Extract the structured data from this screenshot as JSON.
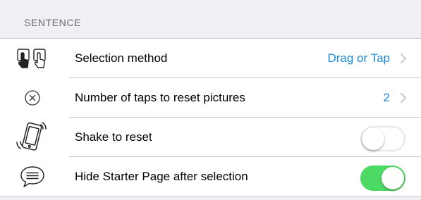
{
  "section": {
    "title": "SENTENCE"
  },
  "rows": [
    {
      "icon": "hand-touch-icon",
      "label": "Selection method",
      "value": "Drag or Tap",
      "accessory": "chevron"
    },
    {
      "icon": "circle-x-icon",
      "label": "Number of taps to reset pictures",
      "value": "2",
      "accessory": "chevron"
    },
    {
      "icon": "phone-shake-icon",
      "label": "Shake to reset",
      "toggle": false
    },
    {
      "icon": "speech-bubble-icon",
      "label": "Hide Starter Page after selection",
      "toggle": true
    }
  ],
  "colors": {
    "background": "#efeff4",
    "value_text": "#1e88d8",
    "toggle_on": "#4cd964",
    "separator": "#c8c7cc"
  }
}
